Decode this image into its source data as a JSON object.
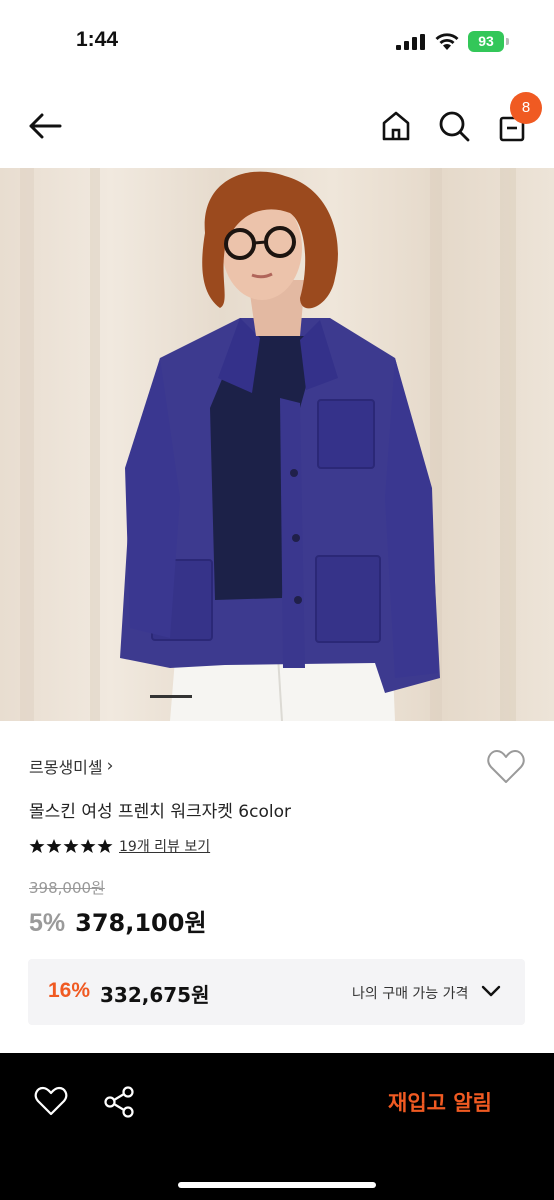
{
  "status_bar": {
    "time": "1:44",
    "battery_level": "93",
    "battery_color": "#33c759"
  },
  "header": {
    "back_icon": "arrow-left-icon",
    "home_icon": "home-icon",
    "search_icon": "search-icon",
    "cart_icon": "shopping-bag-icon",
    "cart_count": "8",
    "badge_color": "#f05a22"
  },
  "gallery": {
    "image_subject": "woman wearing navy french work jacket",
    "current_index": 1
  },
  "product": {
    "brand": "르몽생미셸",
    "brand_chevron": "›",
    "name": "몰스킨 여성 프렌치 워크자켓 6color",
    "rating_stars": 5,
    "review_link": "19개 리뷰 보기",
    "original_price": "398,000원",
    "discount_rate": "5%",
    "sale_price": "378,100원",
    "wish_icon": "heart-outline-icon"
  },
  "my_price": {
    "rate": "16%",
    "price": "332,675원",
    "label": "나의 구매 가능 가격",
    "chevron_icon": "chevron-down-icon"
  },
  "bottom_bar": {
    "wish_icon": "heart-outline-icon",
    "share_icon": "share-icon",
    "restock_label": "재입고 알림",
    "accent_color": "#f05a22"
  }
}
